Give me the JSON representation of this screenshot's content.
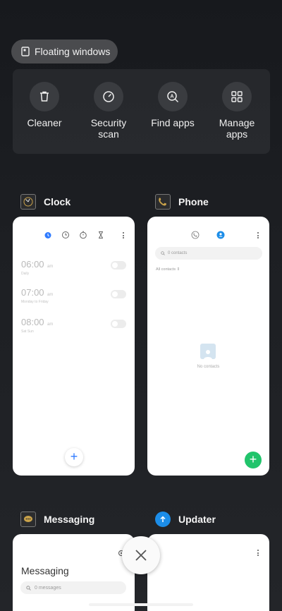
{
  "floating": {
    "label": "Floating windows"
  },
  "tools": [
    {
      "icon": "trash-icon",
      "label": "Cleaner"
    },
    {
      "icon": "gauge-icon",
      "label": "Security scan"
    },
    {
      "icon": "find-apps-icon",
      "label": "Find apps"
    },
    {
      "icon": "grid-icon",
      "label": "Manage apps"
    }
  ],
  "apps": {
    "clock": {
      "name": "Clock",
      "alarms": [
        {
          "time": "06:00",
          "ampm": "am",
          "sub": "Daily"
        },
        {
          "time": "07:00",
          "ampm": "am",
          "sub": "Monday to Friday"
        },
        {
          "time": "08:00",
          "ampm": "am",
          "sub": "Sat Sun"
        }
      ],
      "add": "+"
    },
    "phone": {
      "name": "Phone",
      "search_placeholder": "0 contacts",
      "filter": "All contacts",
      "empty": "No contacts",
      "add": "+"
    },
    "messaging": {
      "name": "Messaging",
      "title": "Messaging",
      "search_placeholder": "0 messages"
    },
    "updater": {
      "name": "Updater"
    }
  },
  "colors": {
    "accent_blue": "#2f7bff",
    "fab_green": "#21c46b",
    "updater_blue": "#1c8de8"
  }
}
